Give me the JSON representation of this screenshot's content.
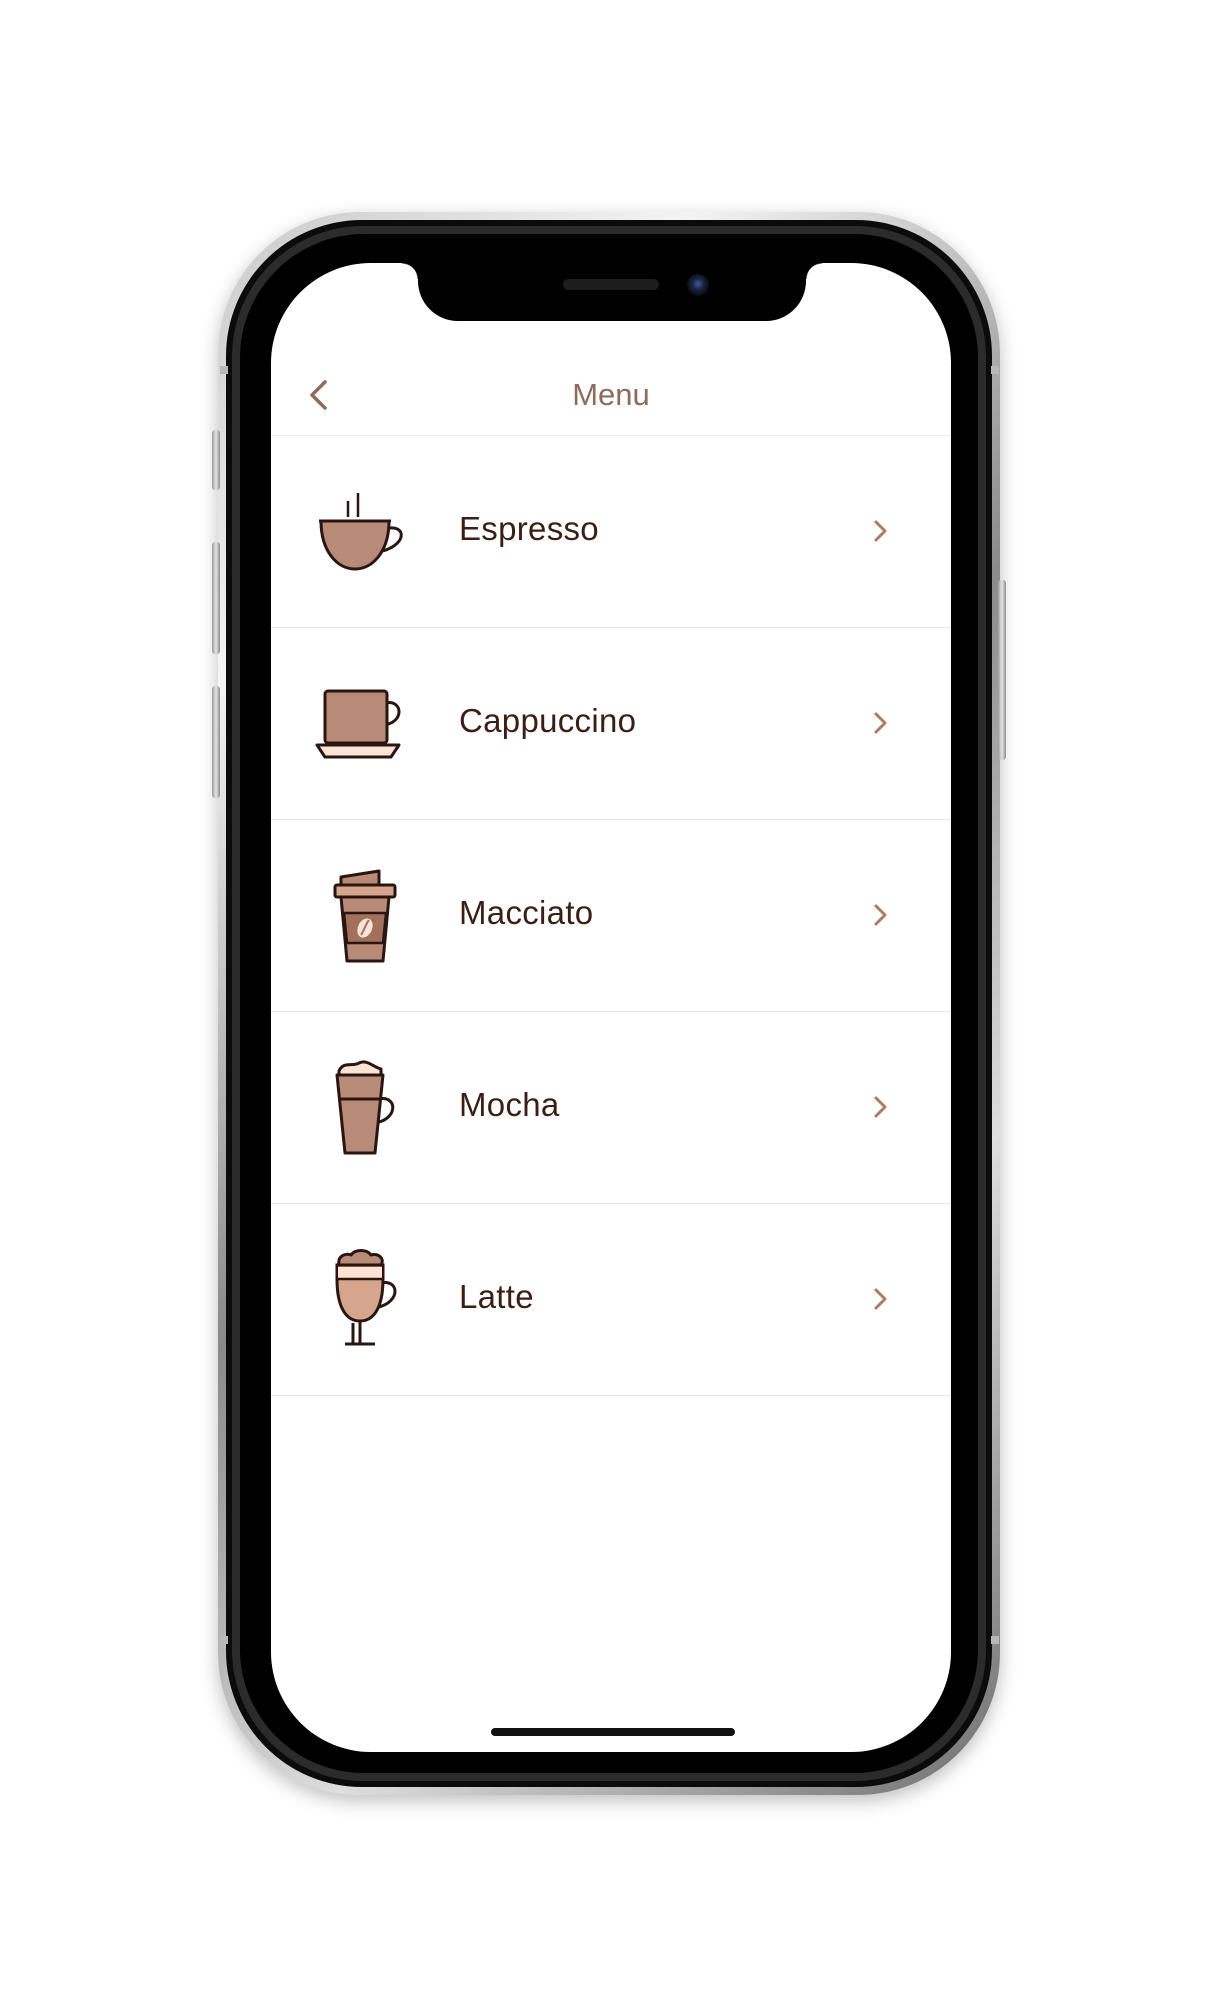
{
  "navbar": {
    "title": "Menu",
    "back_icon": "chevron-left-icon"
  },
  "menu": {
    "items": [
      {
        "label": "Espresso",
        "icon": "espresso-cup-icon"
      },
      {
        "label": "Cappuccino",
        "icon": "cappuccino-cup-icon"
      },
      {
        "label": "Macciato",
        "icon": "takeaway-cup-icon"
      },
      {
        "label": "Mocha",
        "icon": "mocha-glass-icon"
      },
      {
        "label": "Latte",
        "icon": "latte-glass-icon"
      }
    ]
  },
  "colors": {
    "accent": "#b07a63",
    "title": "#8e6b5d",
    "label": "#3b1e14",
    "coffee": "#b88a78",
    "foam": "#fbe3d6",
    "outline": "#2a1510"
  }
}
